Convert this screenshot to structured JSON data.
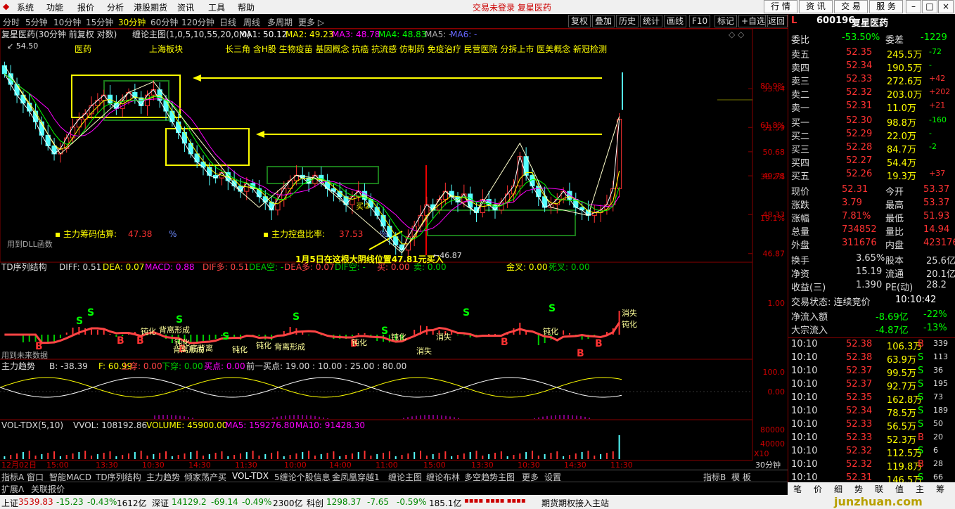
{
  "menu": {
    "items": [
      "系统",
      "功能",
      "报价",
      "分析",
      "港股期货",
      "资讯",
      "工具",
      "帮助"
    ],
    "center": "交易未登录  复星医药",
    "buttons": [
      "行 情",
      "资 讯",
      "交 易",
      "服 务"
    ]
  },
  "toolbar": {
    "periods": [
      "分时",
      "5分钟",
      "10分钟",
      "15分钟",
      "30分钟",
      "60分钟",
      "120分钟",
      "日线",
      "周线",
      "多周期",
      "更多 ▷"
    ],
    "active_index": 4,
    "actions": [
      "复权",
      "叠加",
      "历史",
      "统计",
      "画线",
      "F10",
      "标记",
      "+自选",
      "返回"
    ]
  },
  "main_panel": {
    "title": "复星医药(30分钟 前复权 对数)",
    "indicator": "缠论主图(1,0,5,10,55,20,0,0)",
    "ma": [
      {
        "label": "MA1: 50.12",
        "color": "#ffffff"
      },
      {
        "label": "MA2: 49.23",
        "color": "#ffff00"
      },
      {
        "label": "MA3: 48.78",
        "color": "#ff00ff"
      },
      {
        "label": "MA4: 48.83",
        "color": "#00ff00"
      },
      {
        "label": "MA5: -",
        "color": "#aaaaaa"
      },
      {
        "label": "MA6: -",
        "color": "#6666ff"
      }
    ],
    "high_label": "54.50",
    "low_label": "46.87",
    "sectors": [
      "医药",
      "上海板块"
    ],
    "concepts": "长三角 含H股 生物疫苗 基因概念 抗癌 抗流感 仿制药 免疫治疗 民营医院 分拆上市 医美概念 新冠检测",
    "chip_estimate_label": "主力筹码估算:",
    "chip_estimate_value": "47.38",
    "chip_control_label": "主力控盘比率:",
    "chip_control_value": "37.53",
    "pct_sign": "%",
    "dll_note": "用到DLL函数",
    "annotation": "1月5日在这根大阴线位置47.81元买入",
    "buy_mark": "买②",
    "price_ticks": [
      "53.04",
      "51.59",
      "50.68",
      "49.78",
      "48.33",
      "46.87"
    ],
    "pct_ticks": [
      "80.9%",
      "61.8%",
      "38.2%",
      "19.1%"
    ]
  },
  "td_panel": {
    "items": [
      {
        "t": "TD序列结构",
        "c": "#dddddd"
      },
      {
        "t": "DIFF: 0.51",
        "c": "#dddddd"
      },
      {
        "t": "DEA: 0.07",
        "c": "#ffff00"
      },
      {
        "t": "MACD: 0.88",
        "c": "#ff00ff"
      },
      {
        "t": "DIF多: 0.51",
        "c": "#ff4444"
      },
      {
        "t": "DEA空: -",
        "c": "#00cc00"
      },
      {
        "t": "DEA多: 0.07",
        "c": "#ff4444"
      },
      {
        "t": "DIF空: -",
        "c": "#00cc00"
      },
      {
        "t": "买: 0.00",
        "c": "#ff4444"
      },
      {
        "t": "卖: 0.00",
        "c": "#00cc00"
      },
      {
        "t": "金叉: 0.00",
        "c": "#ffff00"
      },
      {
        "t": "死叉: 0.00",
        "c": "#00cc00"
      }
    ],
    "tick": "1.00",
    "note": "用到未来数据",
    "labels": [
      "钝化",
      "背离形成",
      "钝化",
      "背离形成",
      "钝化",
      "钝化",
      "背离形成",
      "消失",
      "钝化",
      "底背离",
      "钝化",
      "消失",
      "钝化",
      "消失",
      "钝化"
    ]
  },
  "trend_panel": {
    "items": [
      {
        "t": "主力趋势",
        "c": "#dddddd"
      },
      {
        "t": "B: -38.39",
        "c": "#dddddd"
      },
      {
        "t": "F: 60.99",
        "c": "#ffff00"
      },
      {
        "t": "上穿: 0.00",
        "c": "#ff4444"
      },
      {
        "t": "下穿: 0.00",
        "c": "#00cc00"
      },
      {
        "t": "买点: 0.00",
        "c": "#ff00ff"
      },
      {
        "t": "前一买点: 19.00 : 10.00 : 25.00 : 80.00",
        "c": "#dddddd"
      }
    ],
    "ticks": [
      "100.0",
      "0.00"
    ]
  },
  "vol_panel": {
    "items": [
      {
        "t": "VOL-TDX(5,10)",
        "c": "#dddddd"
      },
      {
        "t": "VVOL: 108192.86",
        "c": "#dddddd"
      },
      {
        "t": "VOLUME: 45900.00",
        "c": "#ffff00"
      },
      {
        "t": "MA5: 159276.80",
        "c": "#ff00ff"
      },
      {
        "t": "MA10: 91428.30",
        "c": "#ff00ff"
      }
    ],
    "ticks": [
      "80000",
      "40000"
    ],
    "unit": "X10"
  },
  "time_axis": [
    "12月02日",
    "15:00",
    "13:30",
    "10:30",
    "14:30",
    "11:30",
    "10:00",
    "14:00",
    "11:00",
    "15:00",
    "13:30",
    "10:30",
    "14:30",
    "11:30"
  ],
  "period_label": "30分钟",
  "tabs": [
    "指标A",
    "窗口",
    "智能MACD",
    "TD序列结构",
    "主力趋势",
    "倾家荡产买",
    "VOL-TDX",
    "5缠论个股信息",
    "金凤凰穿越1",
    "缠论主图",
    "缠论布林",
    "多空趋势主图",
    "更多",
    "设置"
  ],
  "tabs_right": [
    "指标B",
    "模 板"
  ],
  "ext_tabs": [
    "扩展Λ",
    "关联报价"
  ],
  "quote": {
    "code": "600196",
    "name": "复星医药",
    "wb_label": "委比",
    "wb": "-53.50%",
    "wc_label": "委差",
    "wc": "-1229",
    "sells": [
      {
        "l": "卖五",
        "p": "52.35",
        "v": "245.5万",
        "c": "-72"
      },
      {
        "l": "卖四",
        "p": "52.34",
        "v": "190.5万",
        "c": "-"
      },
      {
        "l": "卖三",
        "p": "52.33",
        "v": "272.6万",
        "c": "+42"
      },
      {
        "l": "卖二",
        "p": "52.32",
        "v": "203.0万",
        "c": "+202"
      },
      {
        "l": "卖一",
        "p": "52.31",
        "v": "11.0万",
        "c": "+21"
      }
    ],
    "buys": [
      {
        "l": "买一",
        "p": "52.30",
        "v": "98.8万",
        "c": "-160"
      },
      {
        "l": "买二",
        "p": "52.29",
        "v": "22.0万",
        "c": "-"
      },
      {
        "l": "买三",
        "p": "52.28",
        "v": "84.7万",
        "c": "-2"
      },
      {
        "l": "买四",
        "p": "52.27",
        "v": "54.4万",
        "c": ""
      },
      {
        "l": "买五",
        "p": "52.26",
        "v": "19.3万",
        "c": "+37"
      }
    ],
    "stats": [
      {
        "a": "现价",
        "av": "52.31",
        "b": "今开",
        "bv": "53.37"
      },
      {
        "a": "涨跌",
        "av": "3.79",
        "b": "最高",
        "bv": "53.37"
      },
      {
        "a": "涨幅",
        "av": "7.81%",
        "b": "最低",
        "bv": "51.93"
      },
      {
        "a": "总量",
        "av": "734852",
        "b": "量比",
        "bv": "14.94"
      },
      {
        "a": "外盘",
        "av": "311676",
        "b": "内盘",
        "bv": "423176"
      }
    ],
    "stats2": [
      {
        "a": "换手",
        "av": "3.65%",
        "b": "股本",
        "bv": "25.6亿"
      },
      {
        "a": "净资",
        "av": "15.19",
        "b": "流通",
        "bv": "20.1亿"
      },
      {
        "a": "收益(三)",
        "av": "1.390",
        "b": "PE(动)",
        "bv": "28.2"
      }
    ],
    "trade_state_label": "交易状态: 连续竞价",
    "trade_time": "10:10:42",
    "flows": [
      {
        "l": "净流入额",
        "v": "-8.69亿",
        "p": "-22%"
      },
      {
        "l": "大宗流入",
        "v": "-4.87亿",
        "p": "-13%"
      }
    ],
    "ticks": [
      {
        "t": "10:10",
        "p": "52.38",
        "v": "106.3万",
        "s": "B"
      },
      {
        "t": "10:10",
        "p": "52.38",
        "v": "63.9万",
        "s": "S"
      },
      {
        "t": "10:10",
        "p": "52.37",
        "v": "99.5万",
        "s": "S"
      },
      {
        "t": "10:10",
        "p": "52.37",
        "v": "92.7万",
        "s": "S"
      },
      {
        "t": "10:10",
        "p": "52.35",
        "v": "162.8万",
        "s": "S"
      },
      {
        "t": "10:10",
        "p": "52.34",
        "v": "78.5万",
        "s": "S"
      },
      {
        "t": "10:10",
        "p": "52.33",
        "v": "56.5万",
        "s": "S"
      },
      {
        "t": "10:10",
        "p": "52.33",
        "v": "52.3万",
        "s": "B"
      },
      {
        "t": "10:10",
        "p": "52.32",
        "v": "112.5万",
        "s": "S"
      },
      {
        "t": "10:10",
        "p": "52.32",
        "v": "119.8万",
        "s": "B"
      },
      {
        "t": "10:10",
        "p": "52.31",
        "v": "146.5万",
        "s": "S"
      }
    ],
    "tick_counts": [
      "339",
      "113",
      "36",
      "195",
      "73",
      "189",
      "50",
      "20",
      "6",
      "28",
      "66"
    ]
  },
  "right_tabs": [
    "笔",
    "价",
    "细",
    "势",
    "联",
    "值",
    "主",
    "筹"
  ],
  "status": {
    "sh_label": "上证",
    "sh": "3539.83",
    "sh_chg": "-15.23",
    "sh_pct": "-0.43%",
    "sh_amt": "1612亿",
    "sz_label": "深证",
    "sz": "14129.2",
    "sz_chg": "-69.14",
    "sz_pct": "-0.49%",
    "sz_amt": "2300亿",
    "kc_label": "科创",
    "kc": "1298.37",
    "kc_chg": "-7.65",
    "kc_pct": "-0.59%",
    "kc_amt": "185.1亿",
    "news": "期货期权接入主站",
    "watermark": "junzhuan.com"
  },
  "chart_data": {
    "type": "candlestick",
    "interval": "30分钟",
    "price_range": [
      46.87,
      54.5
    ],
    "closes": [
      53.6,
      53.2,
      52.8,
      52.5,
      52.2,
      51.8,
      51.3,
      50.9,
      50.6,
      50.8,
      51.2,
      51.6,
      51.9,
      52.1,
      52.4,
      52.6,
      52.8,
      52.5,
      52.3,
      52.6,
      52.9,
      52.7,
      52.4,
      52.8,
      53.0,
      52.6,
      52.2,
      51.8,
      51.4,
      51.0,
      50.6,
      50.3,
      50.1,
      49.8,
      49.7,
      49.9,
      49.6,
      49.4,
      49.2,
      49.5,
      49.3,
      49.0,
      48.8,
      48.5,
      48.9,
      49.3,
      49.6,
      49.8,
      49.7,
      49.5,
      49.8,
      49.6,
      49.3,
      49.2,
      49.0,
      48.7,
      49.0,
      49.2,
      48.9,
      48.6,
      48.3,
      47.9,
      47.5,
      47.2,
      47.0,
      47.5,
      47.9,
      48.3,
      48.7,
      48.5,
      48.9,
      49.2,
      49.0,
      48.8,
      49.1,
      48.6,
      48.4,
      48.9,
      48.7,
      48.5,
      48.8,
      49.1,
      49.4,
      50.5,
      49.8,
      49.4,
      49.0,
      48.6,
      48.7,
      48.9,
      49.2,
      48.9,
      48.6,
      48.5,
      48.3,
      48.4,
      48.5,
      48.7,
      49.3,
      51.9
    ],
    "volume_scale": [
      0,
      80000
    ]
  }
}
